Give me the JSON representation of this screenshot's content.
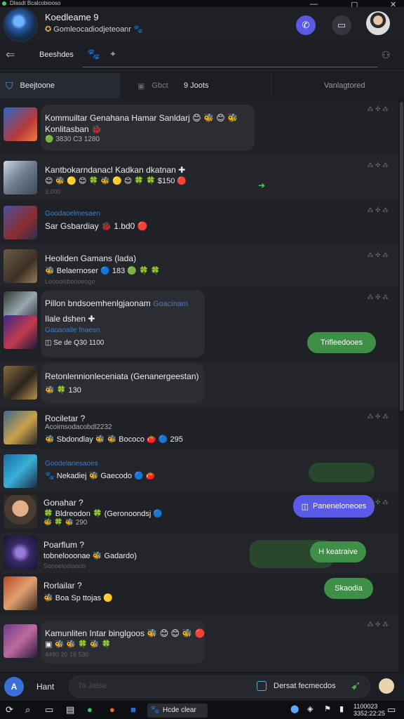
{
  "titlebar": {
    "text": "Dlasdt Bcalcobiooso"
  },
  "header": {
    "name": "Koedleame 9",
    "subtitle": "Gomleocadiodjeteoanr",
    "window_controls": [
      "—",
      "▢",
      "✕"
    ]
  },
  "subbar": {
    "title": "Beeshdes"
  },
  "tabs": [
    {
      "label": "Beejtoone"
    },
    {
      "label": "Gbct"
    },
    {
      "label": "9 Joots"
    },
    {
      "label": "Vanlagtored"
    }
  ],
  "rows": [
    {
      "lines": [
        "Kommuiltar Genahana Hamar Sanldarj 😊 🐝 😊 🐝",
        "Konlitasban 🐞",
        "🟢 3830 C3  1280"
      ]
    },
    {
      "lines": [
        "Kantbokarndanacl Kadkan dkatnan ✚",
        "😊 🐝 🟡 😊 🍀 🐝 🟡 😊 🍀 🍀 $150 🔴",
        "3.000"
      ]
    },
    {
      "lines": [
        "Goodaoelmesaen",
        "Sar Gsbardiay 🐞 1.bd0 🔴"
      ]
    },
    {
      "lines": [
        "Heoliden Gamans (lada)",
        "🐝 Belaernoser 🔵 183 🟢 🍀 🍀",
        "Loooolsboooeoge"
      ]
    },
    {
      "lines": [
        "Pillon bndsoemhenlgjaonam",
        "Goacinam",
        "Ilale dshen ✚",
        "Gaoaoaile fnaesn",
        "◫ Se de Q30 1100"
      ],
      "button": "Trifleedooes"
    },
    {
      "lines": [
        "Retonlennionleceniata (Genanergeestan)",
        "🐝 🍀 130"
      ]
    },
    {
      "lines": [
        "Rociletar ?",
        "Acoimsodacobdl2232",
        "🐝 Sbdondlay 🐝 🐝 Bococo 🍅 🔵 295"
      ]
    },
    {
      "lines": [
        "Goodelanesaoes",
        "🐾 Nekadiej 🐝 Gaecodo 🔵 🍅"
      ]
    },
    {
      "lines": [
        "Gonahar ?",
        "🍀 Bldreodon 🍀 (Geronoondsj 🔵",
        "🐝 🍀 🐝 290"
      ],
      "button": "Paneneloneoes"
    },
    {
      "lines": [
        "Poarflum ?",
        "tobnelooonae 🐝 Gadardo)",
        "Soooeloolaoob"
      ],
      "button": "H keatraive"
    },
    {
      "lines": [
        "Rorlailar ?",
        "🐝 Boa Sp ttojas 🟡"
      ],
      "button": "Skaodia"
    },
    {
      "lines": [
        "Kamunliten Intar binglgoos 🐝 😊 😊 🐝 🔴",
        "▣ 🐝 🐝 🍀 🐝 🍀",
        "4480 20 16 530"
      ]
    }
  ],
  "composer": {
    "avatar_letter": "A",
    "label": "Hant",
    "placeholder": "Ta Jatse",
    "hint": "Dersat fecmecdos"
  },
  "taskbar": {
    "app_label": "Hcde clear",
    "time": "1100023",
    "date": "3352:22:25"
  }
}
